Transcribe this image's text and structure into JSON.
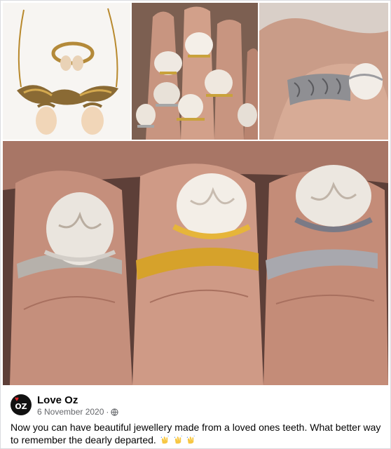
{
  "post": {
    "page_name": "Love Oz",
    "date": "6 November 2020",
    "separator": "·",
    "avatar": {
      "text": "OZ",
      "heart": "♥",
      "accent": "#e4262c"
    },
    "caption": "Now you can have beautiful jewellery made from a loved ones teeth. What better way to remember the dearly departed.",
    "caption_emojis": [
      "clapping-hands-icon",
      "clapping-hands-icon",
      "clapping-hands-icon"
    ],
    "privacy_icon": "globe-icon"
  },
  "photos": [
    {
      "name": "necklace-and-ring-photo"
    },
    {
      "name": "multiple-tooth-rings-photo"
    },
    {
      "name": "silver-tooth-ring-photo"
    },
    {
      "name": "three-tooth-rings-photo"
    }
  ],
  "colors": {
    "meta_text": "#65676b",
    "text": "#050505",
    "border": "#d9dbdf"
  }
}
